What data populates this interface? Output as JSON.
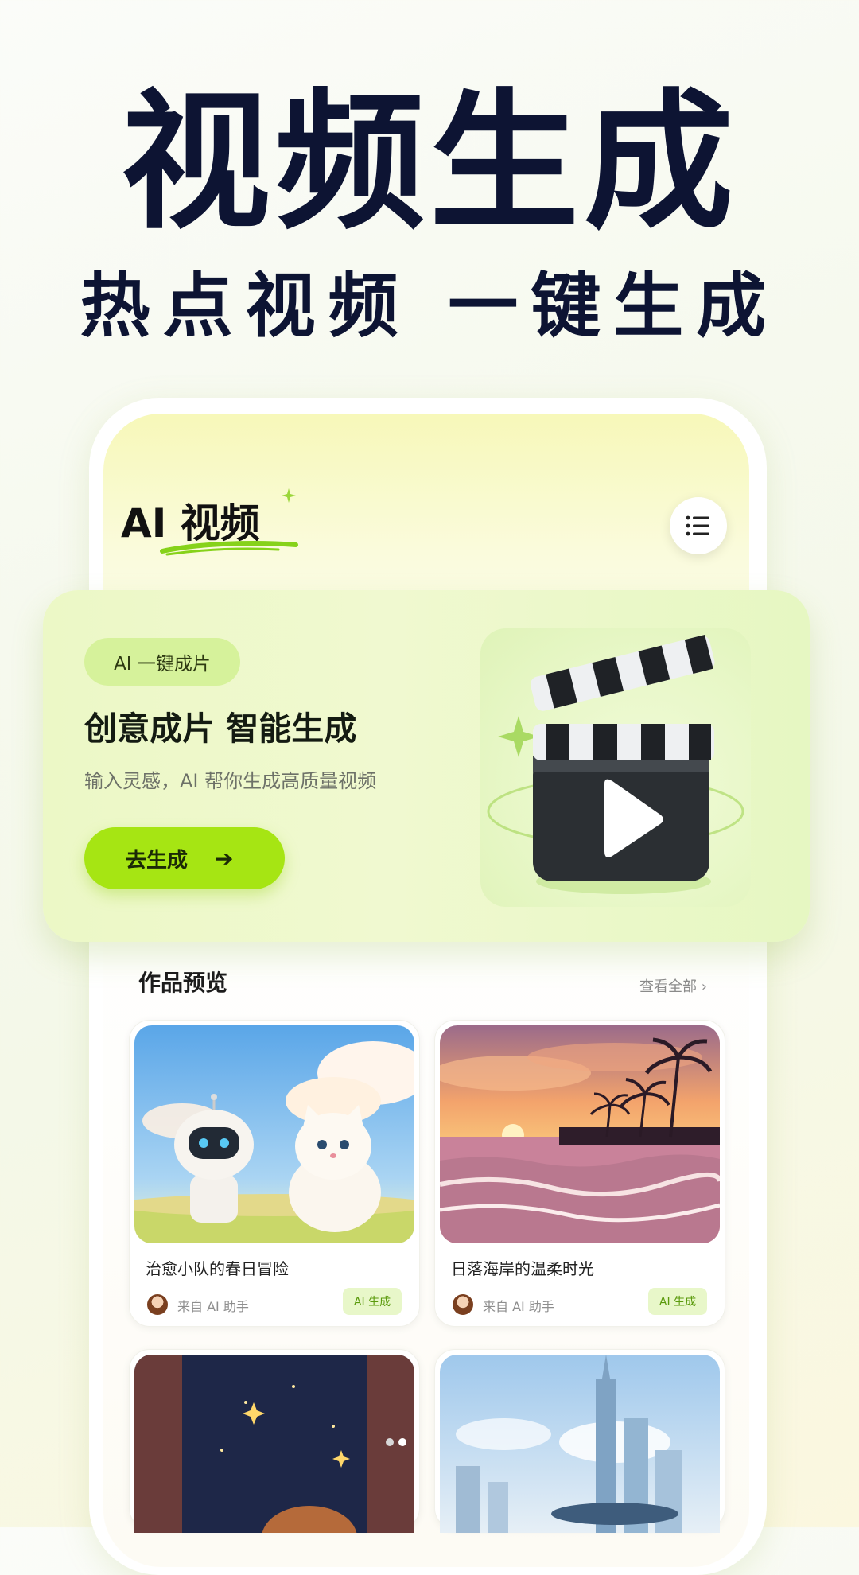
{
  "hero": {
    "title": "视频生成",
    "subtitle": "热点视频 一键生成"
  },
  "app": {
    "title": "AI 视频",
    "menu_icon": "list-icon"
  },
  "banner": {
    "badge": "AI 一键成片",
    "title": "创意成片  智能生成",
    "description": "输入灵感，AI 帮你生成高质量视频",
    "button_label": "去生成",
    "button_icon": "arrow-right-icon",
    "illustration": "clapperboard-play-icon"
  },
  "works": {
    "title": "作品预览",
    "view_all": "查看全部 ›",
    "items": [
      {
        "caption": "治愈小队的春日冒险",
        "source": "来自 AI 助手",
        "tag": "AI 生成"
      },
      {
        "caption": "日落海岸的温柔时光",
        "source": "来自 AI 助手",
        "tag": "AI 生成"
      }
    ]
  },
  "colors": {
    "accent": "#a6e513",
    "title": "#0d1433",
    "badge_bg": "#d6f29b"
  }
}
